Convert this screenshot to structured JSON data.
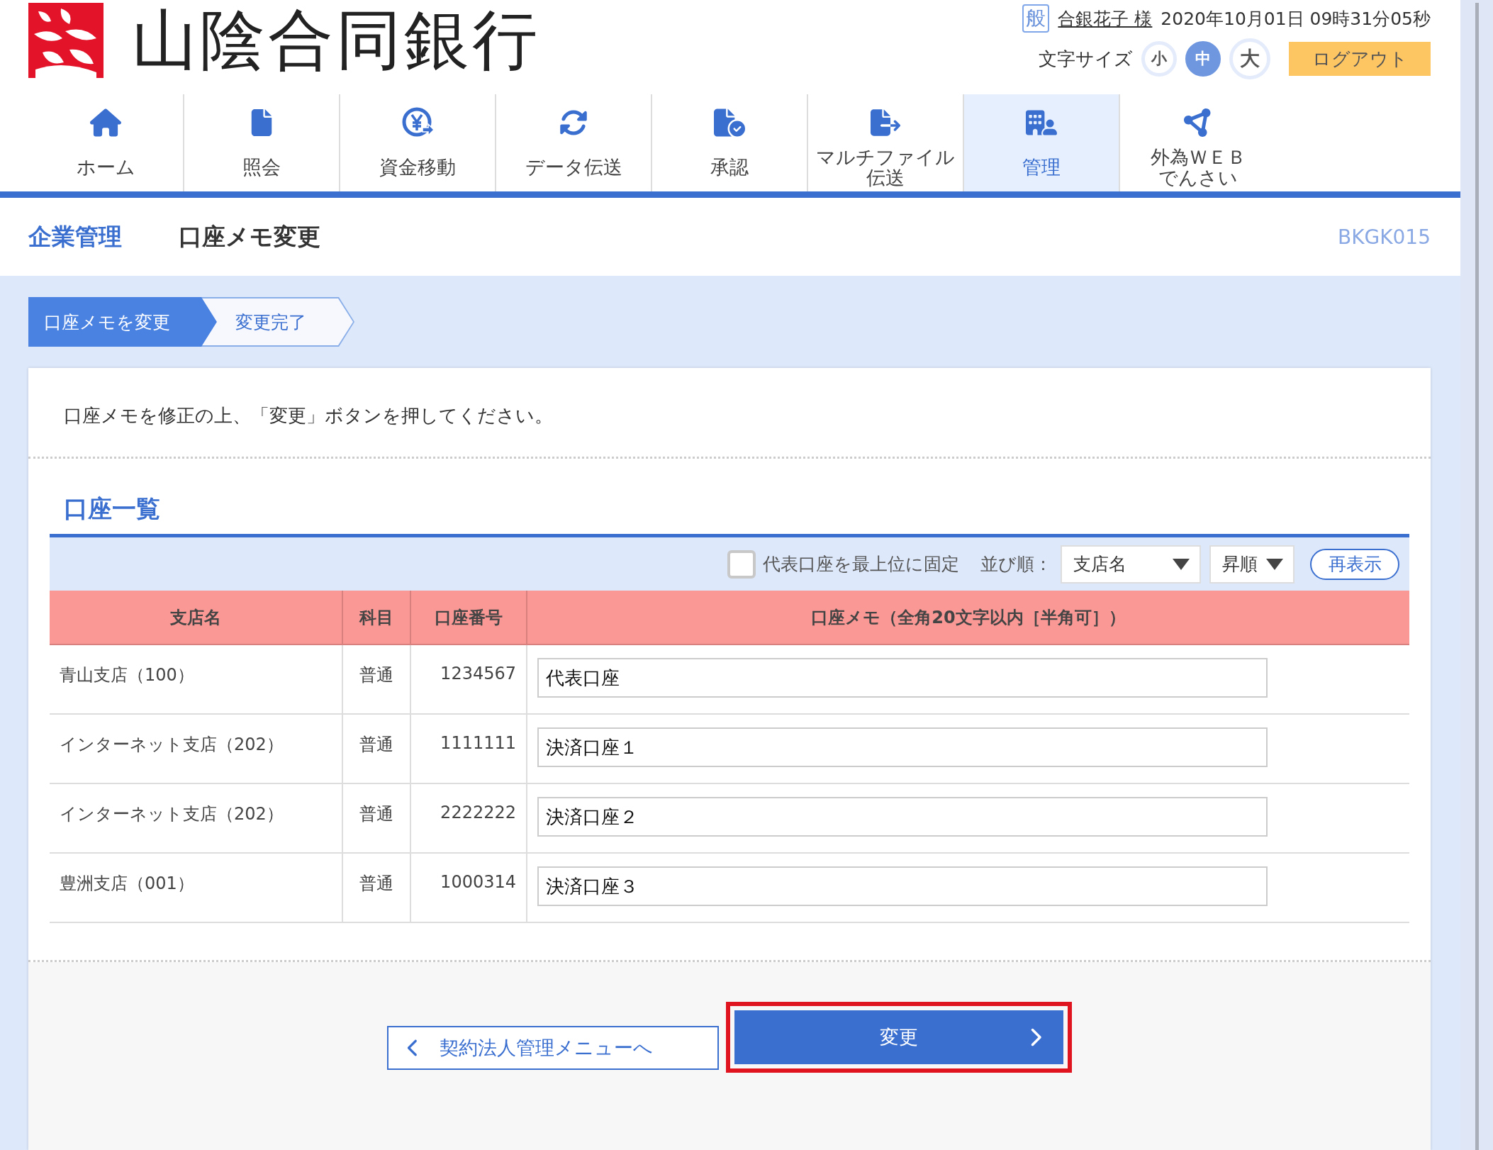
{
  "header": {
    "bank_name": "山陰合同銀行",
    "user_badge": "般",
    "user_name": "合銀花子 様",
    "datetime": "2020年10月01日 09時31分05秒",
    "font_size_label": "文字サイズ",
    "font_sizes": [
      {
        "label": "小",
        "selected": false
      },
      {
        "label": "中",
        "selected": true
      },
      {
        "label": "大",
        "selected": false
      }
    ],
    "logout": "ログアウト"
  },
  "nav": [
    {
      "kind": "home",
      "label_lines": [
        "ホーム"
      ],
      "selected": false
    },
    {
      "kind": "document",
      "label_lines": [
        "照会"
      ],
      "selected": false
    },
    {
      "kind": "yen",
      "label_lines": [
        "資金移動"
      ],
      "selected": false
    },
    {
      "kind": "sync",
      "label_lines": [
        "データ伝送"
      ],
      "selected": false
    },
    {
      "kind": "approve",
      "label_lines": [
        "承認"
      ],
      "selected": false
    },
    {
      "kind": "export",
      "label_lines": [
        "マルチファイル",
        "伝送"
      ],
      "selected": false
    },
    {
      "kind": "admin",
      "label_lines": [
        "管理"
      ],
      "selected": true
    },
    {
      "kind": "nodes",
      "label_lines": [
        "外為ＷＥＢ",
        "でんさい"
      ],
      "selected": false
    }
  ],
  "page_header": {
    "section": "企業管理",
    "title": "口座メモ変更",
    "screen_id": "BKGK015"
  },
  "steps": [
    {
      "label": "口座メモを変更",
      "selected": true
    },
    {
      "label": "変更完了",
      "selected": false
    }
  ],
  "instruction": "口座メモを修正の上、「変更」ボタンを押してください。",
  "account_list": {
    "title": "口座一覧",
    "pin_label": "代表口座を最上位に固定",
    "pin_checked": false,
    "sort_label": "並び順：",
    "sort_field": "支店名",
    "sort_order": "昇順",
    "refresh": "再表示",
    "columns": [
      "支店名",
      "科目",
      "口座番号",
      "口座メモ（全角20文字以内［半角可］）"
    ],
    "rows": [
      {
        "branch": "青山支店（100）",
        "type": "普通",
        "number": "1234567",
        "memo": "代表口座"
      },
      {
        "branch": "インターネット支店（202）",
        "type": "普通",
        "number": "1111111",
        "memo": "決済口座１"
      },
      {
        "branch": "インターネット支店（202）",
        "type": "普通",
        "number": "2222222",
        "memo": "決済口座２"
      },
      {
        "branch": "豊洲支店（001）",
        "type": "普通",
        "number": "1000314",
        "memo": "決済口座３"
      }
    ]
  },
  "buttons": {
    "back": "契約法人管理メニューへ",
    "submit": "変更",
    "submit_highlighted": true
  }
}
